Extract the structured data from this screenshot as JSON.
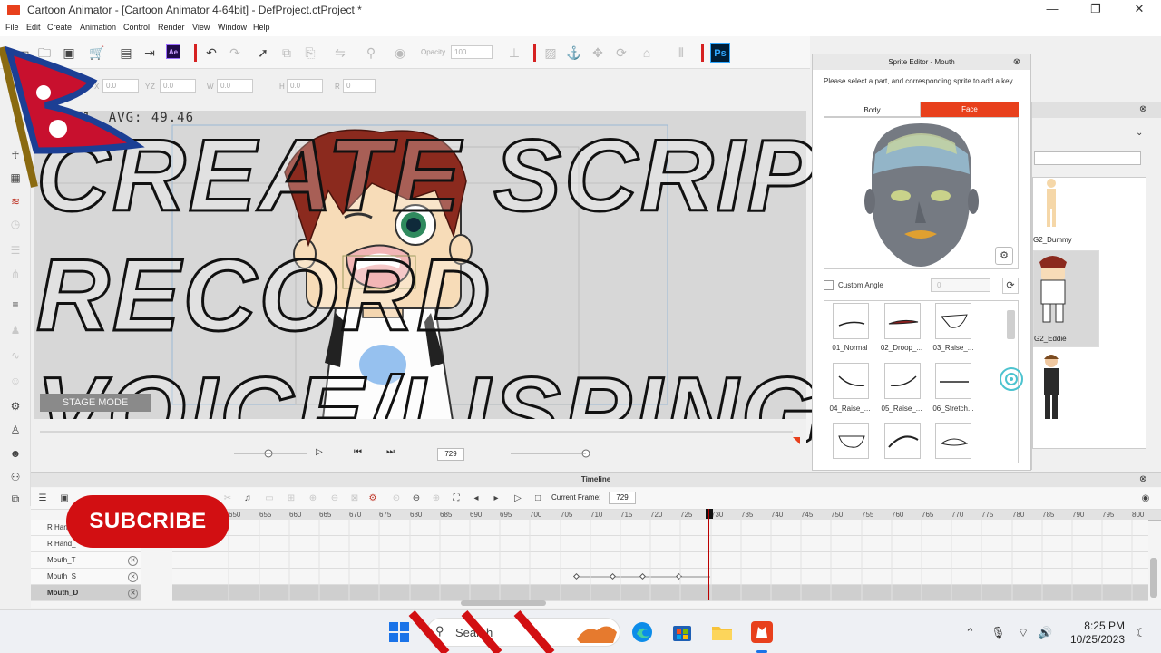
{
  "window": {
    "title": "Cartoon Animator - [Cartoon Animator 4-64bit] - DefProject.ctProject *",
    "minimize": "—",
    "maximize": "❐",
    "close": "✕"
  },
  "menu": [
    "File",
    "Edit",
    "Create",
    "Animation",
    "Control",
    "Render",
    "View",
    "Window",
    "Help"
  ],
  "toolbar": {
    "opacity_label": "Opacity",
    "opacity_value": "100",
    "ae_label": "Ae",
    "ps_label": "Ps"
  },
  "transform": {
    "x_label": "X",
    "x_value": "0.0",
    "y_label": "Y",
    "y_value": "0.0",
    "z_label": "Z",
    "z_value": "0.0",
    "w_label": "W",
    "w_value": "0.0",
    "h_label": "H",
    "h_value": "0.0",
    "r_label": "R",
    "r_value": "0"
  },
  "stage": {
    "fps_text": "41. AVG: 49.46",
    "stage_mode": "STAGE MODE",
    "frame": "729"
  },
  "overlay": {
    "line1": "CREATE SCRIPT",
    "line2": "RECORD",
    "line3": "VOICE/LISPING"
  },
  "sprite_editor": {
    "title": "Sprite Editor - Mouth",
    "instruction": "Please select a part, and corresponding sprite to add a key.",
    "tab_body": "Body",
    "tab_face": "Face",
    "custom_angle": "Custom Angle",
    "angle_value": "0",
    "sprites": [
      "01_Normal",
      "02_Droop_...",
      "03_Raise_...",
      "04_Raise_...",
      "05_Raise_...",
      "06_Stretch..."
    ]
  },
  "content_manager": {
    "items": [
      "G2_Dummy",
      "G2_Eddie"
    ]
  },
  "timeline": {
    "title": "Timeline",
    "current_frame_label": "Current Frame:",
    "current_frame": "729",
    "ticks": [
      "650",
      "655",
      "660",
      "665",
      "670",
      "675",
      "680",
      "685",
      "690",
      "695",
      "700",
      "705",
      "710",
      "715",
      "720",
      "725",
      "730",
      "735",
      "740",
      "745",
      "750",
      "755",
      "760",
      "765",
      "770",
      "775",
      "780",
      "785",
      "790",
      "795",
      "800"
    ],
    "tracks": [
      "R Hand",
      "R Hand_",
      "Mouth_T",
      "Mouth_S",
      "Mouth_D"
    ]
  },
  "subscribe": "SUBCRIBE",
  "taskbar": {
    "search": "Search",
    "time": "8:25 PM",
    "date": "10/25/2023"
  },
  "colors": {
    "accent": "#e8401c",
    "subscribe": "#d20f12",
    "timeline_playhead": "#b00000"
  }
}
